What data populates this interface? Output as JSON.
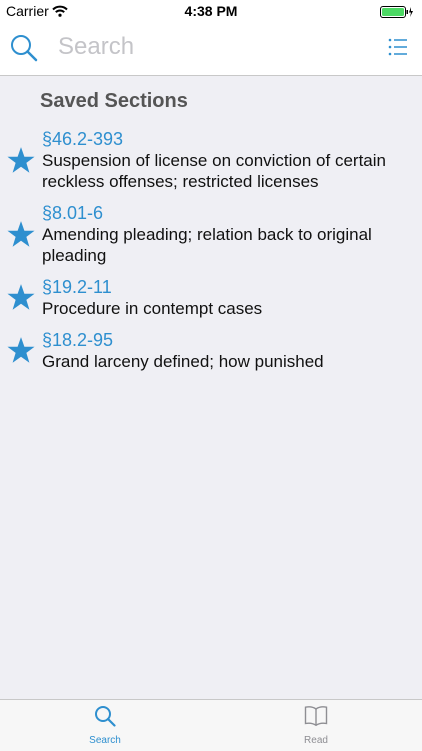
{
  "status_bar": {
    "carrier": "Carrier",
    "time": "4:38 PM"
  },
  "search": {
    "placeholder": "Search",
    "icon": "search-icon",
    "menu_icon": "list-icon"
  },
  "colors": {
    "accent": "#2e8fcf",
    "background": "#efeff4",
    "battery": "#4cd964"
  },
  "saved": {
    "heading": "Saved Sections",
    "items": [
      {
        "code": "§46.2-393",
        "title": "Suspension of license on conviction of certain reckless offenses; restricted licenses"
      },
      {
        "code": "§8.01-6",
        "title": "Amending pleading; relation back to original pleading"
      },
      {
        "code": "§19.2-11",
        "title": "Procedure in contempt cases"
      },
      {
        "code": "§18.2-95",
        "title": "Grand larceny defined; how punished"
      }
    ]
  },
  "tabs": [
    {
      "label": "Search",
      "icon": "search-icon",
      "selected": true
    },
    {
      "label": "Read",
      "icon": "book-icon",
      "selected": false
    }
  ]
}
